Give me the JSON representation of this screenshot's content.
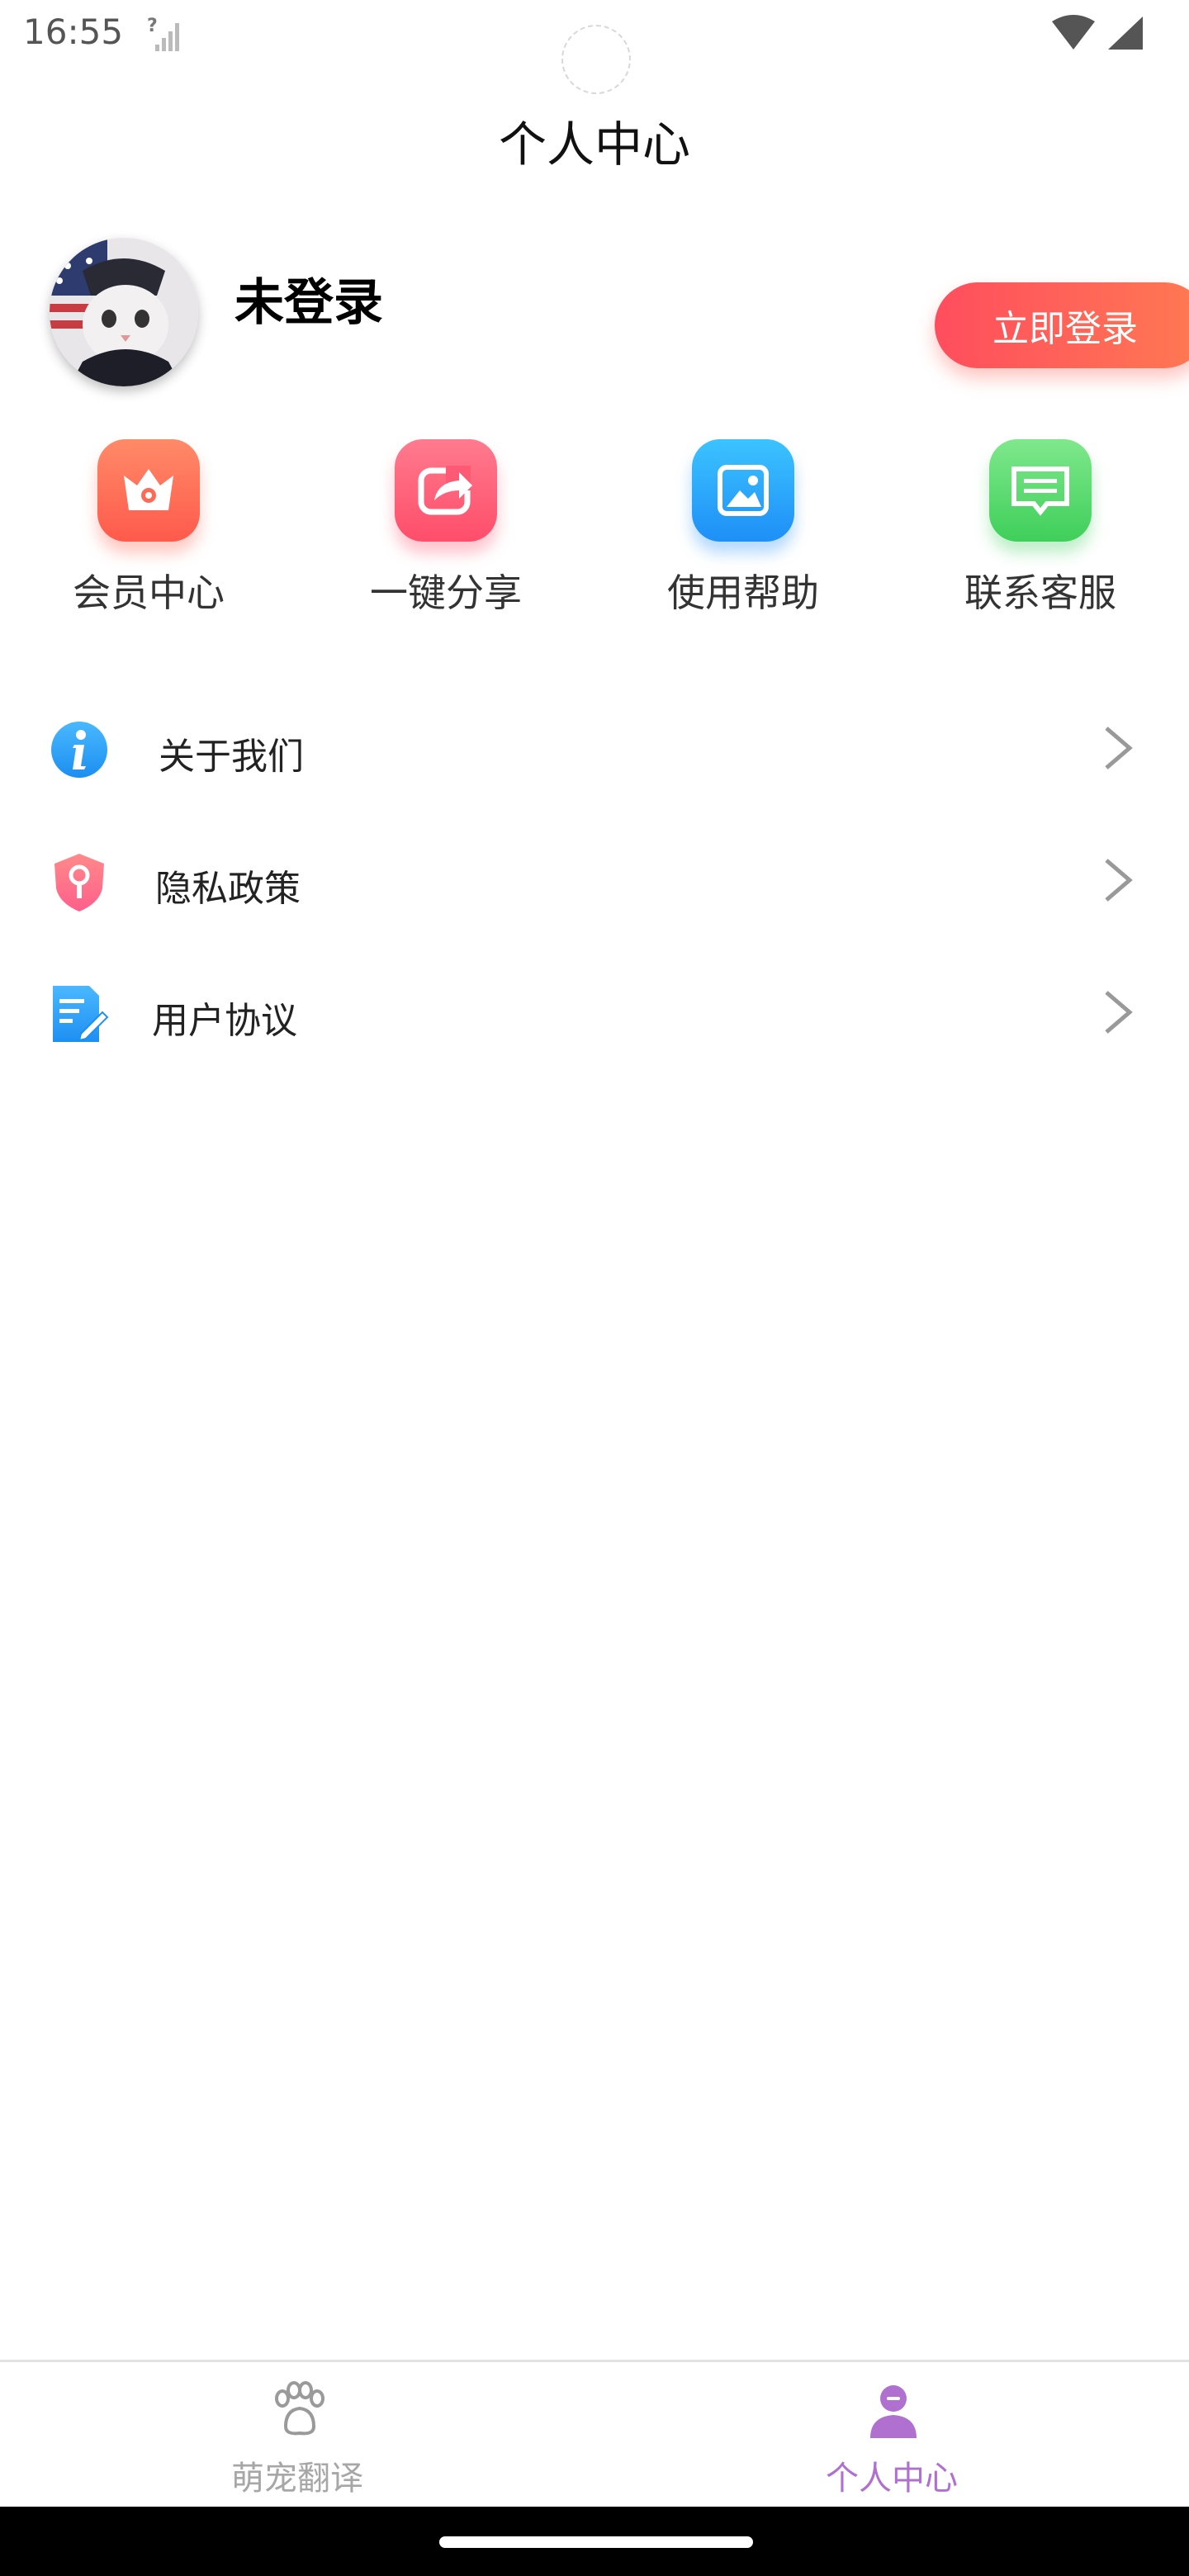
{
  "status_bar": {
    "time": "16:55",
    "icons": [
      "signal-unknown-icon",
      "wifi-icon",
      "cell-signal-icon"
    ]
  },
  "header": {
    "title": "个人中心"
  },
  "profile": {
    "username": "未登录",
    "login_button": "立即登录",
    "avatar": "cat-avatar"
  },
  "quick_actions": [
    {
      "label": "会员中心",
      "icon": "crown-icon",
      "color": "#ff6a55"
    },
    {
      "label": "一键分享",
      "icon": "share-icon",
      "color": "#ff5a75"
    },
    {
      "label": "使用帮助",
      "icon": "image-icon",
      "color": "#2a9cf8"
    },
    {
      "label": "联系客服",
      "icon": "message-icon",
      "color": "#4fd86a"
    }
  ],
  "menu": [
    {
      "label": "关于我们",
      "icon": "info-icon"
    },
    {
      "label": "隐私政策",
      "icon": "shield-key-icon"
    },
    {
      "label": "用户协议",
      "icon": "document-edit-icon"
    }
  ],
  "bottom_nav": [
    {
      "label": "萌宠翻译",
      "icon": "paw-icon",
      "active": false
    },
    {
      "label": "个人中心",
      "icon": "user-icon",
      "active": true
    }
  ],
  "colors": {
    "accent_gradient_start": "#ff4d5e",
    "accent_gradient_end": "#ff7a52",
    "active_tab": "#b070d0",
    "inactive_tab": "#a7a7a7"
  }
}
